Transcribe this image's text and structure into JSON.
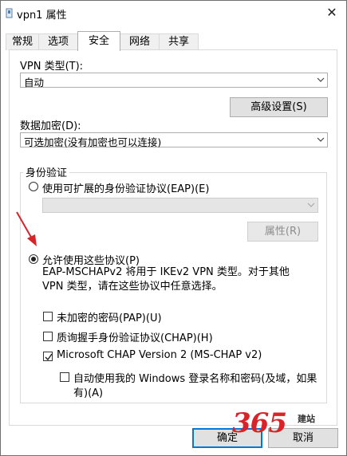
{
  "window": {
    "title": "vpn1 属性",
    "close_glyph": "✕"
  },
  "tabs": [
    {
      "label": "常规"
    },
    {
      "label": "选项"
    },
    {
      "label": "安全",
      "active": true
    },
    {
      "label": "网络"
    },
    {
      "label": "共享"
    }
  ],
  "vpn_type": {
    "label": "VPN 类型(T):",
    "value": "自动"
  },
  "advanced_button": "高级设置(S)",
  "encryption": {
    "label": "数据加密(D):",
    "value": "可选加密(没有加密也可以连接)"
  },
  "auth": {
    "group_title": "身份验证",
    "eap_radio": "使用可扩展的身份验证协议(EAP)(E)",
    "eap_combo_value": "",
    "properties_button": "属性(R)",
    "allow_radio": "允许使用这些协议(P)",
    "description": "EAP-MSCHAPv2 将用于 IKEv2 VPN 类型。对于其他 VPN 类型，请在这些协议中任意选择。",
    "protocols": [
      {
        "label": "未加密的密码(PAP)(U)",
        "checked": false
      },
      {
        "label": "质询握手身份验证协议(CHAP)(H)",
        "checked": false
      },
      {
        "label": "Microsoft CHAP Version 2 (MS-CHAP v2)",
        "checked": true
      }
    ],
    "auto_logon": {
      "line1": "自动使用我的 Windows 登录名称和密码(及域，如果",
      "line2": "有)(A)",
      "checked": false
    }
  },
  "footer": {
    "ok": "确定",
    "cancel": "取消"
  },
  "watermark": {
    "number": "365",
    "text": "建站"
  },
  "colors": {
    "accent": "#0078d7",
    "arrow": "#d8232a"
  }
}
